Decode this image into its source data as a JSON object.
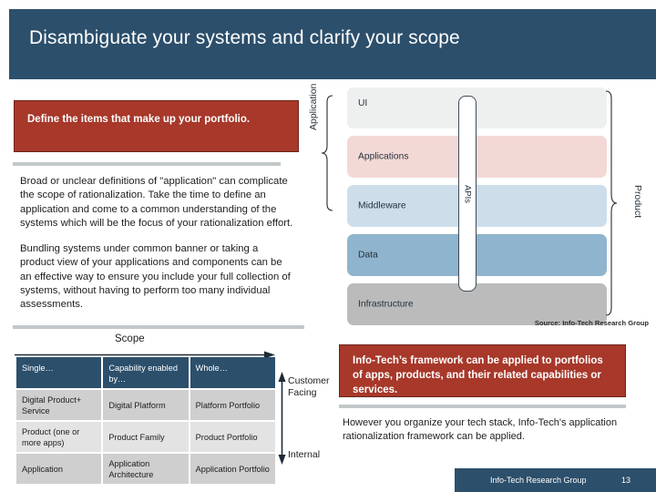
{
  "header": {
    "title": "Disambiguate your systems and clarify your scope"
  },
  "left": {
    "callout": "Define the items that make up your portfolio.",
    "paragraphs": [
      "Broad or unclear definitions of \"application\" can complicate the scope of rationalization. Take the time to define an application and come to a common understanding of the systems which will be the focus of your rationalization effort.",
      "Bundling systems under common banner or taking a product view of your applications and components can be an effective way to ensure you include your full collection of systems, without having to perform too many individual assessments."
    ]
  },
  "diagram": {
    "layers": [
      {
        "label": "UI",
        "color": "#eef0f0"
      },
      {
        "label": "Applications",
        "color": "#f3d9d5"
      },
      {
        "label": "Middleware",
        "color": "#cddeea"
      },
      {
        "label": "Data",
        "color": "#8fb4cd"
      },
      {
        "label": "Infrastructure",
        "color": "#bbbbbb"
      }
    ],
    "apis_label": "APIs",
    "bracket_left_label": "Application",
    "bracket_right_label": "Product",
    "source": "Source: Info-Tech Research Group"
  },
  "matrix": {
    "scope_label": "Scope",
    "headers": [
      "Single…",
      "Capability enabled by…",
      "Whole…"
    ],
    "rows": [
      [
        "Digital Product+ Service",
        "Digital Platform",
        "Platform Portfolio"
      ],
      [
        "Product (one or more apps)",
        "Product Family",
        "Product Portfolio"
      ],
      [
        "Application",
        "Application Architecture",
        "Application Portfolio"
      ]
    ],
    "axis_top": "Customer\nFacing",
    "axis_bottom": "Internal"
  },
  "right": {
    "callout": "Info-Tech’s framework can be applied to portfolios of apps, products, and their related capabilities or services.",
    "paragraph": "However you organize your tech stack, Info-Tech's application rationalization framework can be applied."
  },
  "footer": {
    "name": "Info-Tech Research Group",
    "page": "13"
  },
  "colors": {
    "navy": "#2c4f6b",
    "brick": "#a7382a",
    "rule_gray": "#c3c7c9"
  }
}
